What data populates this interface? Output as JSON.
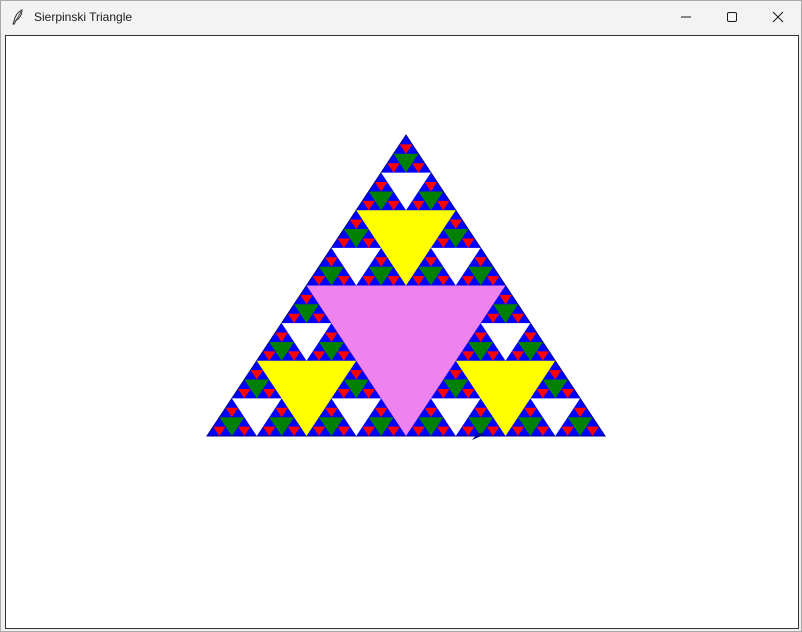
{
  "window": {
    "title": "Sierpinski Triangle",
    "app_icon": "feather-icon",
    "controls": [
      "minimize-icon",
      "maximize-icon",
      "close-icon"
    ]
  },
  "fractal": {
    "depth": 5,
    "outline_color": "#00008b",
    "level_colors": {
      "blue": "#0000ff",
      "violet": "#ee82ee",
      "yellow": "#ffff00",
      "white": "#ffffff",
      "green": "#008000",
      "red": "#ff0000"
    }
  }
}
